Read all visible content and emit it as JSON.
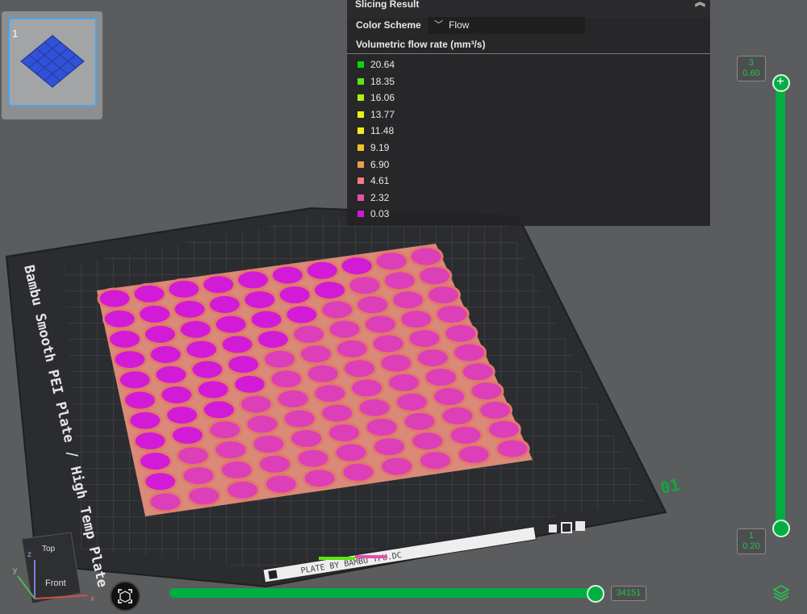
{
  "thumbnail": {
    "plate_number": "1"
  },
  "slicing_result": {
    "title": "Slicing Result",
    "color_scheme_label": "Color Scheme",
    "color_scheme_value": "Flow",
    "legend_title": "Volumetric flow rate (mm³/s)",
    "legend": [
      {
        "value": "20.64",
        "color": "#0bd40b"
      },
      {
        "value": "18.35",
        "color": "#5ce60e"
      },
      {
        "value": "16.06",
        "color": "#b3ee14"
      },
      {
        "value": "13.77",
        "color": "#e6f21a"
      },
      {
        "value": "11.48",
        "color": "#f5ec1e"
      },
      {
        "value": "9.19",
        "color": "#f7c322"
      },
      {
        "value": "6.90",
        "color": "#f19b4e"
      },
      {
        "value": "4.61",
        "color": "#ef7f78"
      },
      {
        "value": "2.32",
        "color": "#e54fa8"
      },
      {
        "value": "0.03",
        "color": "#d417d4"
      }
    ]
  },
  "layer_slider": {
    "top_layer": "3",
    "top_height": "0.60",
    "bottom_layer": "1",
    "bottom_height": "0.20"
  },
  "move_slider": {
    "value": "34151"
  },
  "plate": {
    "label": "Bambu Smooth PEI Plate / High Temp Plate",
    "plate_id": "01",
    "bottom_text": "PLATE BY BAMBU TPU.DC"
  },
  "view_cube": {
    "top_label": "Top",
    "front_label": "Front",
    "x": "x",
    "y": "y",
    "z": "z"
  },
  "colors": {
    "accent": "#00ae42",
    "dot_fill": "#d21bd6",
    "dot_stroke": "#e07a6a"
  }
}
